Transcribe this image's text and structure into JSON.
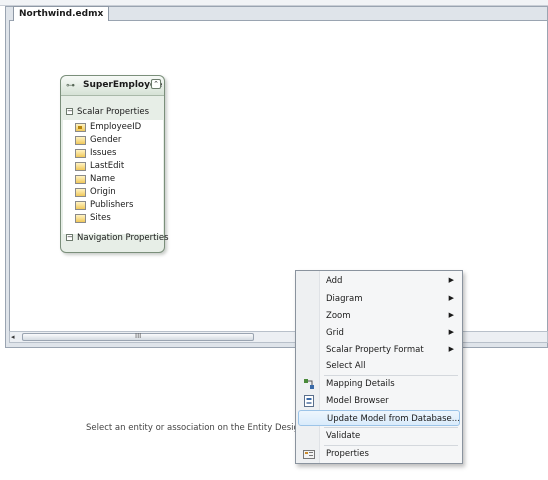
{
  "tab": {
    "title": "Northwind.edmx"
  },
  "entity": {
    "name": "SuperEmployee",
    "scalar_section": "Scalar Properties",
    "properties": [
      "EmployeeID",
      "Gender",
      "Issues",
      "LastEdit",
      "Name",
      "Origin",
      "Publishers",
      "Sites"
    ],
    "nav_section": "Navigation Properties",
    "collapse_glyph": "⌃"
  },
  "scrollbar": {
    "left_arrow": "◂",
    "grip": "III"
  },
  "status": {
    "text": "Select an entity or association on the Entity Designer to"
  },
  "context_menu": {
    "items": [
      {
        "label": "Add",
        "submenu": true
      },
      {
        "label": "Diagram",
        "submenu": true
      },
      {
        "label": "Zoom",
        "submenu": true
      },
      {
        "label": "Grid",
        "submenu": true
      },
      {
        "label": "Scalar Property Format",
        "submenu": true
      },
      {
        "label": "Select All",
        "submenu": false
      },
      {
        "label": "Mapping Details",
        "submenu": false,
        "icon": "mapping-details-icon"
      },
      {
        "label": "Model Browser",
        "submenu": false,
        "icon": "model-browser-icon"
      },
      {
        "label": "Update Model from Database...",
        "submenu": false,
        "highlighted": true
      },
      {
        "label": "Validate",
        "submenu": false
      },
      {
        "label": "Properties",
        "submenu": false,
        "icon": "properties-icon"
      }
    ],
    "arrow_glyph": "▶"
  }
}
